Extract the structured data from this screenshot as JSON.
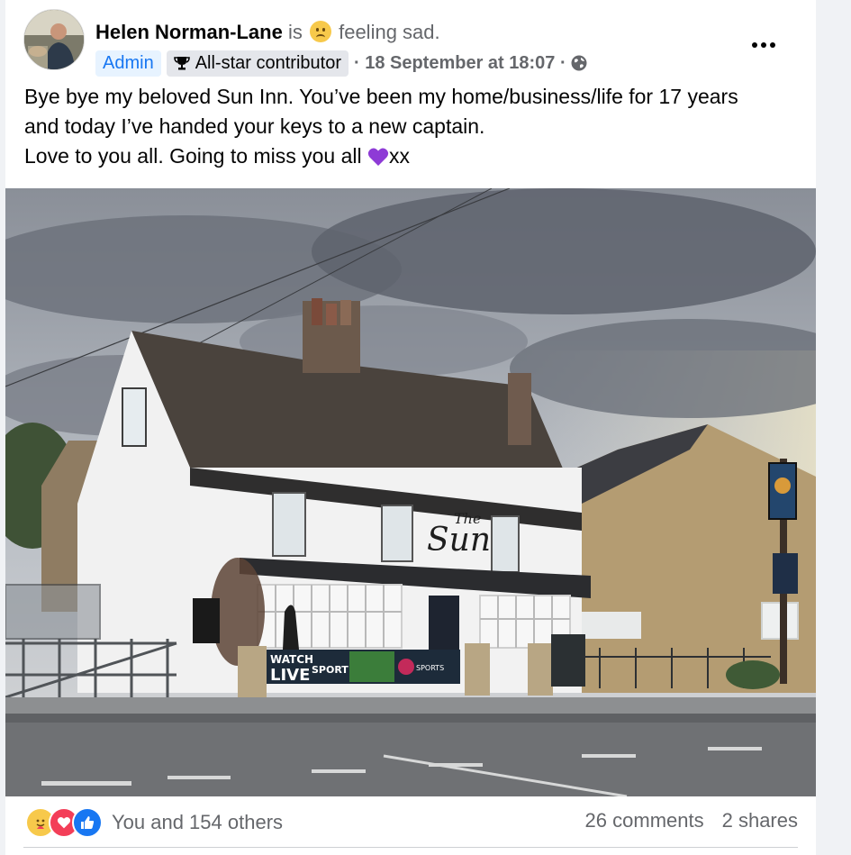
{
  "post": {
    "author": "Helen Norman-Lane",
    "is_word": "is",
    "feeling_text": "feeling sad.",
    "badges": {
      "admin": "Admin",
      "contributor": "All-star contributor"
    },
    "timestamp": "· 18 September at 18:07 ·",
    "text_lines": [
      "Bye bye my beloved Sun Inn. You’ve been my home/business/life for 17 years",
      "and today I’ve handed your keys to a new captain.",
      "Love to you all. Going to miss you all",
      "xx"
    ],
    "photo_signage": {
      "pub_name_small": "The",
      "pub_name": "Sun",
      "banner_watch": "WATCH",
      "banner_live": "LIVE",
      "banner_sport": "SPORT",
      "banner_sports_logo": "SPORTS"
    }
  },
  "footer": {
    "reaction_summary": "You and 154 others",
    "comments": "26 comments",
    "shares": "2 shares"
  },
  "icons": {
    "more": "more-options-icon",
    "globe": "public-globe-icon",
    "trophy": "trophy-icon",
    "feeling": "sad-face-emoji",
    "heart": "purple-heart-emoji"
  },
  "colors": {
    "accent": "#1877f2",
    "muted": "#65676b",
    "heart": "#8e3bd6"
  }
}
